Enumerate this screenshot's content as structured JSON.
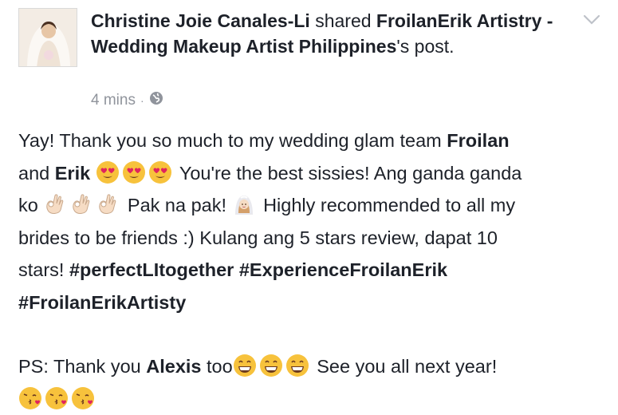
{
  "author": {
    "name": "Christine Joie Canales-Li",
    "verb": " shared ",
    "page": "FroilanErik Artistry - Wedding Makeup Artist Philippines",
    "suffix": "'s post."
  },
  "meta": {
    "time": "4 mins",
    "separator": "·",
    "privacy_icon": "globe-icon"
  },
  "post": {
    "line1_a": "Yay! Thank you so much to my wedding glam team ",
    "line1_b": "Froilan",
    "line2_a": "and ",
    "line2_b": "Erik",
    "line2_c": "You're the best sissies! Ang ganda ganda",
    "line3_a": "ko ",
    "line3_b": "Pak na pak! ",
    "line3_c": "Highly recommended to all my",
    "line4": "brides to be friends :) Kulang ang 5 stars review, dapat 10",
    "line5_a": "stars! ",
    "hashtag1": "#perfectLItogether",
    "hashtag2": "#ExperienceFroilanErik",
    "hashtag3": "#FroilanErikArtisty",
    "ps_a": "PS: Thank you ",
    "ps_b": "Alexis",
    "ps_c": " too",
    "ps_d": "See you all next year!"
  },
  "emojis": {
    "heart_eyes": "heart-eyes-emoji",
    "ok_hand": "ok-hand-emoji",
    "bride": "bride-with-veil-emoji",
    "grin": "grinning-emoji",
    "kiss": "face-blowing-kiss-emoji"
  },
  "colors": {
    "text": "#1d2129",
    "meta": "#90949c",
    "emoji_yellow": "#f7c23c",
    "heart_red": "#e0245e",
    "skin": "#f6dcc4"
  }
}
